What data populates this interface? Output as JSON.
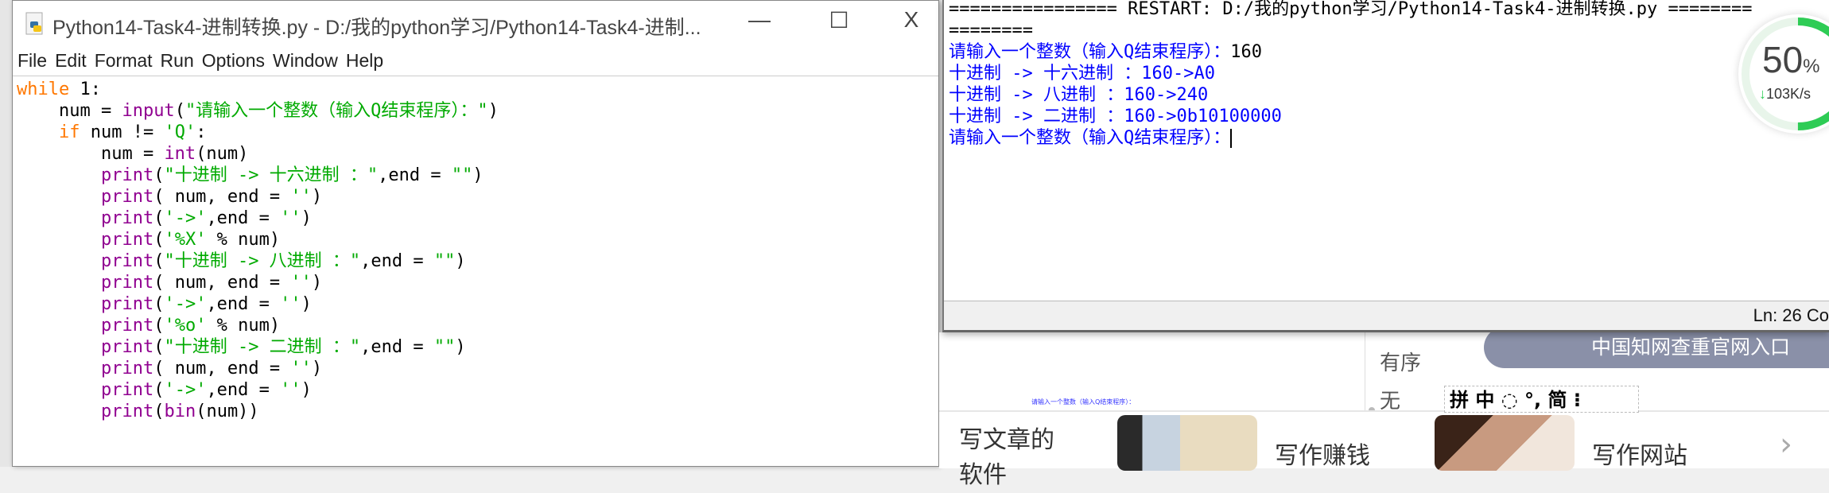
{
  "editor": {
    "title": "Python14-Task4-进制转换.py - D:/我的python学习/Python14-Task4-进制...",
    "controls": {
      "minimize": "—",
      "maximize": "☐",
      "close": "X"
    },
    "menu": [
      "File",
      "Edit",
      "Format",
      "Run",
      "Options",
      "Window",
      "Help"
    ],
    "code_lines": [
      [
        [
          "while",
          "kw"
        ],
        [
          " 1:",
          ""
        ]
      ],
      [
        [
          "    num = ",
          ""
        ],
        [
          "input",
          "bi"
        ],
        [
          "(",
          ""
        ],
        [
          "\"请输入一个整数（输入Q结束程序）：\"",
          "st"
        ],
        [
          ")",
          ""
        ]
      ],
      [
        [
          "    ",
          ""
        ],
        [
          "if",
          "kw"
        ],
        [
          " num != ",
          ""
        ],
        [
          "'Q'",
          "st"
        ],
        [
          ":",
          ""
        ]
      ],
      [
        [
          "        num = ",
          ""
        ],
        [
          "int",
          "bi"
        ],
        [
          "(num)",
          ""
        ]
      ],
      [
        [
          "        ",
          ""
        ],
        [
          "print",
          "bi"
        ],
        [
          "(",
          ""
        ],
        [
          "\"十进制 -> 十六进制 ：\"",
          "st"
        ],
        [
          ",end = ",
          ""
        ],
        [
          "\"\"",
          "st"
        ],
        [
          ")",
          ""
        ]
      ],
      [
        [
          "        ",
          ""
        ],
        [
          "print",
          "bi"
        ],
        [
          "( num, end = ",
          ""
        ],
        [
          "''",
          "st"
        ],
        [
          ")",
          ""
        ]
      ],
      [
        [
          "        ",
          ""
        ],
        [
          "print",
          "bi"
        ],
        [
          "(",
          ""
        ],
        [
          "'->'",
          "st"
        ],
        [
          ",end = ",
          ""
        ],
        [
          "''",
          "st"
        ],
        [
          ")",
          ""
        ]
      ],
      [
        [
          "        ",
          ""
        ],
        [
          "print",
          "bi"
        ],
        [
          "(",
          ""
        ],
        [
          "'%X'",
          "st"
        ],
        [
          " % num)",
          ""
        ]
      ],
      [
        [
          "        ",
          ""
        ],
        [
          "print",
          "bi"
        ],
        [
          "(",
          ""
        ],
        [
          "\"十进制 -> 八进制 ：\"",
          "st"
        ],
        [
          ",end = ",
          ""
        ],
        [
          "\"\"",
          "st"
        ],
        [
          ")",
          ""
        ]
      ],
      [
        [
          "        ",
          ""
        ],
        [
          "print",
          "bi"
        ],
        [
          "( num, end = ",
          ""
        ],
        [
          "''",
          "st"
        ],
        [
          ")",
          ""
        ]
      ],
      [
        [
          "        ",
          ""
        ],
        [
          "print",
          "bi"
        ],
        [
          "(",
          ""
        ],
        [
          "'->'",
          "st"
        ],
        [
          ",end = ",
          ""
        ],
        [
          "''",
          "st"
        ],
        [
          ")",
          ""
        ]
      ],
      [
        [
          "        ",
          ""
        ],
        [
          "print",
          "bi"
        ],
        [
          "(",
          ""
        ],
        [
          "'%o'",
          "st"
        ],
        [
          " % num)",
          ""
        ]
      ],
      [
        [
          "        ",
          ""
        ],
        [
          "print",
          "bi"
        ],
        [
          "(",
          ""
        ],
        [
          "\"十进制 -> 二进制 ：\"",
          "st"
        ],
        [
          ",end = ",
          ""
        ],
        [
          "\"\"",
          "st"
        ],
        [
          ")",
          ""
        ]
      ],
      [
        [
          "        ",
          ""
        ],
        [
          "print",
          "bi"
        ],
        [
          "( num, end = ",
          ""
        ],
        [
          "''",
          "st"
        ],
        [
          ")",
          ""
        ]
      ],
      [
        [
          "        ",
          ""
        ],
        [
          "print",
          "bi"
        ],
        [
          "(",
          ""
        ],
        [
          "'->'",
          "st"
        ],
        [
          ",end = ",
          ""
        ],
        [
          "''",
          "st"
        ],
        [
          ")",
          ""
        ]
      ],
      [
        [
          "        ",
          ""
        ],
        [
          "print",
          "bi"
        ],
        [
          "(",
          ""
        ],
        [
          "bin",
          "bi"
        ],
        [
          "(num))",
          ""
        ]
      ]
    ]
  },
  "shell": {
    "lines": [
      [
        [
          "================ RESTART: D:/我的python学习/Python14-Task4-进制转换.py ========",
          "rst"
        ]
      ],
      [
        [
          "========",
          "rst"
        ]
      ],
      [
        [
          "请输入一个整数（输入Q结束程序）：",
          "out"
        ],
        [
          "160",
          "usr"
        ]
      ],
      [
        [
          "十进制 -> 十六进制 ：160->A0",
          "out"
        ]
      ],
      [
        [
          "十进制 -> 八进制 ：160->240",
          "out"
        ]
      ],
      [
        [
          "十进制 -> 二进制 ：160->0b10100000",
          "out"
        ]
      ],
      [
        [
          "请输入一个整数（输入Q结束程序）：",
          "out"
        ]
      ]
    ],
    "status": "Ln: 26  Co"
  },
  "net_widget": {
    "percent_value": "50",
    "percent_sign": "%",
    "speed": "103K/s",
    "ring_color": "#2ecc55",
    "fill_fraction": 0.5
  },
  "web": {
    "side_item_1": "有序",
    "side_item_2": "无",
    "pill_button": "中国知网查重官网入口",
    "tiny_text": "请输入一个整数（输入Q结束程序）：",
    "ime_bar": "拼 中 ◌ °, 简 ⁝",
    "cards": [
      {
        "label": "写文章的",
        "label2": "软件"
      },
      {
        "label": "写作赚钱"
      },
      {
        "label": "写作网站"
      }
    ],
    "next_icon": "›"
  }
}
